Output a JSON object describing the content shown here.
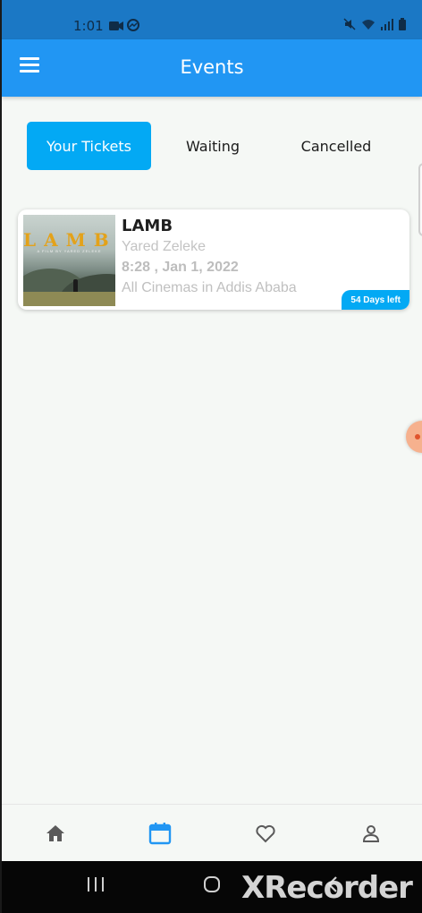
{
  "status_bar": {
    "time": "1:01",
    "left_icons": [
      "video-recording-icon",
      "messenger-icon"
    ],
    "right_icons": [
      "mute-icon",
      "wifi-icon",
      "signal-icon",
      "battery-icon"
    ]
  },
  "app_bar": {
    "title": "Events",
    "menu_icon": "menu-icon"
  },
  "tabs": [
    {
      "label": "Your Tickets",
      "active": true
    },
    {
      "label": "Waiting",
      "active": false
    },
    {
      "label": "Cancelled",
      "active": false
    }
  ],
  "tickets": [
    {
      "title": "LAMB",
      "director": "Yared Zeleke",
      "datetime": "8:28 , Jan 1, 2022",
      "venue": "All Cinemas in Addis Ababa",
      "days_left": "54 Days left",
      "poster": {
        "title": "LAMB",
        "subtitle": "A FILM BY YARED ZELEKE"
      }
    }
  ],
  "bottom_nav": {
    "items": [
      {
        "icon": "home-icon",
        "active": false
      },
      {
        "icon": "calendar-icon",
        "active": true
      },
      {
        "icon": "heart-icon",
        "active": false
      },
      {
        "icon": "person-icon",
        "active": false
      }
    ]
  },
  "system_nav": {
    "buttons": [
      "recent-apps-icon",
      "home-circle-icon",
      "back-icon"
    ]
  },
  "watermark": "XRecorder",
  "colors": {
    "primary": "#2196f3",
    "accent": "#03a9f4",
    "status_bar": "#1b78c5",
    "background": "#f5f8f5"
  }
}
